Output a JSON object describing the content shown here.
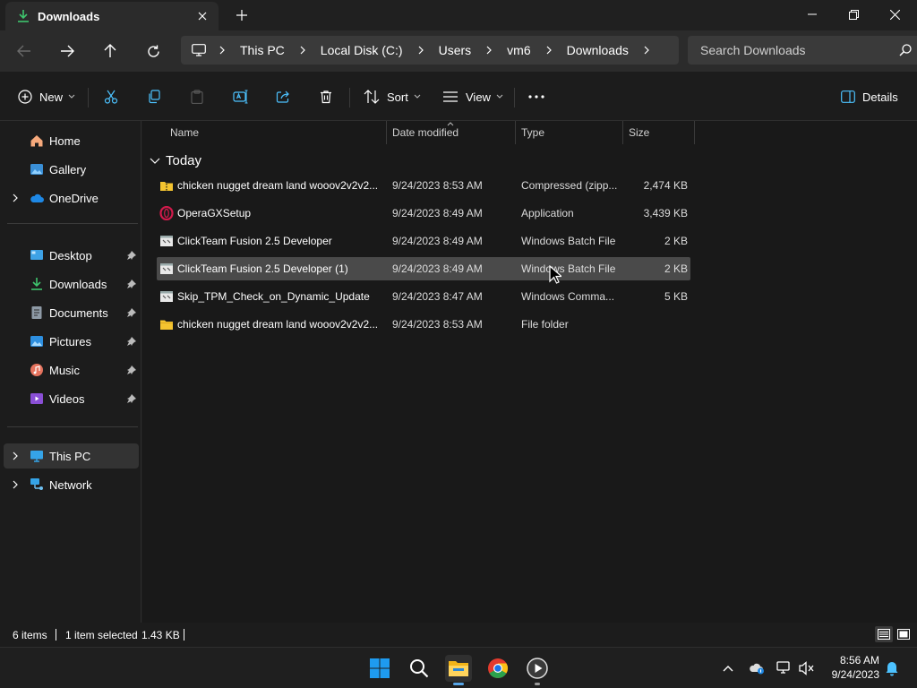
{
  "window": {
    "tab_title": "Downloads",
    "minimize_icon": "minimize-icon",
    "maximize_icon": "restore-icon",
    "close_icon": "close-icon"
  },
  "address": {
    "crumbs": [
      "This PC",
      "Local Disk (C:)",
      "Users",
      "vm6",
      "Downloads"
    ],
    "search_placeholder": "Search Downloads"
  },
  "toolbar": {
    "new_label": "New",
    "sort_label": "Sort",
    "view_label": "View",
    "details_label": "Details"
  },
  "sidebar": {
    "items": [
      {
        "label": "Home",
        "icon": "home-icon"
      },
      {
        "label": "Gallery",
        "icon": "gallery-icon"
      },
      {
        "label": "OneDrive",
        "icon": "onedrive-icon"
      },
      {
        "label": "Desktop",
        "icon": "desktop-icon"
      },
      {
        "label": "Downloads",
        "icon": "downloads-icon"
      },
      {
        "label": "Documents",
        "icon": "documents-icon"
      },
      {
        "label": "Pictures",
        "icon": "pictures-icon"
      },
      {
        "label": "Music",
        "icon": "music-icon"
      },
      {
        "label": "Videos",
        "icon": "videos-icon"
      },
      {
        "label": "This PC",
        "icon": "this-pc-icon"
      },
      {
        "label": "Network",
        "icon": "network-icon"
      }
    ]
  },
  "columns": {
    "name": "Name",
    "date": "Date modified",
    "type": "Type",
    "size": "Size"
  },
  "group": {
    "label": "Today"
  },
  "files": [
    {
      "name": "chicken nugget dream land wooov2v2v2...",
      "date": "9/24/2023 8:53 AM",
      "type": "Compressed (zipp...",
      "size": "2,474 KB",
      "icon": "zip-folder-icon"
    },
    {
      "name": "OperaGXSetup",
      "date": "9/24/2023 8:49 AM",
      "type": "Application",
      "size": "3,439 KB",
      "icon": "opera-gx-icon"
    },
    {
      "name": "ClickTeam Fusion 2.5 Developer",
      "date": "9/24/2023 8:49 AM",
      "type": "Windows Batch File",
      "size": "2 KB",
      "icon": "batch-file-icon"
    },
    {
      "name": "ClickTeam Fusion 2.5 Developer (1)",
      "date": "9/24/2023 8:49 AM",
      "type": "Windows Batch File",
      "size": "2 KB",
      "icon": "batch-file-icon"
    },
    {
      "name": "Skip_TPM_Check_on_Dynamic_Update",
      "date": "9/24/2023 8:47 AM",
      "type": "Windows Comma...",
      "size": "5 KB",
      "icon": "batch-file-icon"
    },
    {
      "name": "chicken nugget dream land wooov2v2v2...",
      "date": "9/24/2023 8:53 AM",
      "type": "File folder",
      "size": "",
      "icon": "folder-icon"
    }
  ],
  "status": {
    "items_count": "6 items",
    "selection": "1 item selected",
    "selection_size": "1.43 KB"
  },
  "clock": {
    "time": "8:56 AM",
    "date": "9/24/2023"
  },
  "colors": {
    "accent": "#4cc2ff",
    "folder": "#f4c430",
    "selected_row": "#4a4a4a"
  }
}
